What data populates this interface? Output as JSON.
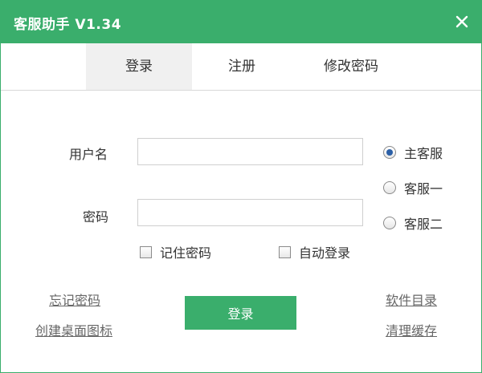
{
  "window": {
    "title": "客服助手 V1.34",
    "close_icon": "close-icon",
    "accent_color": "#3aae6c"
  },
  "tabs": [
    {
      "label": "登录",
      "active": true
    },
    {
      "label": "注册",
      "active": false
    },
    {
      "label": "修改密码",
      "active": false
    }
  ],
  "form": {
    "username_label": "用户名",
    "username_value": "",
    "password_label": "密码",
    "password_value": ""
  },
  "servers": [
    {
      "label": "主客服",
      "checked": true
    },
    {
      "label": "客服一",
      "checked": false
    },
    {
      "label": "客服二",
      "checked": false
    }
  ],
  "options": {
    "remember_password": "记住密码",
    "auto_login": "自动登录"
  },
  "links": {
    "forgot_password": "忘记密码",
    "create_shortcut": "创建桌面图标",
    "software_dir": "软件目录",
    "clear_cache": "清理缓存"
  },
  "buttons": {
    "login": "登录"
  }
}
